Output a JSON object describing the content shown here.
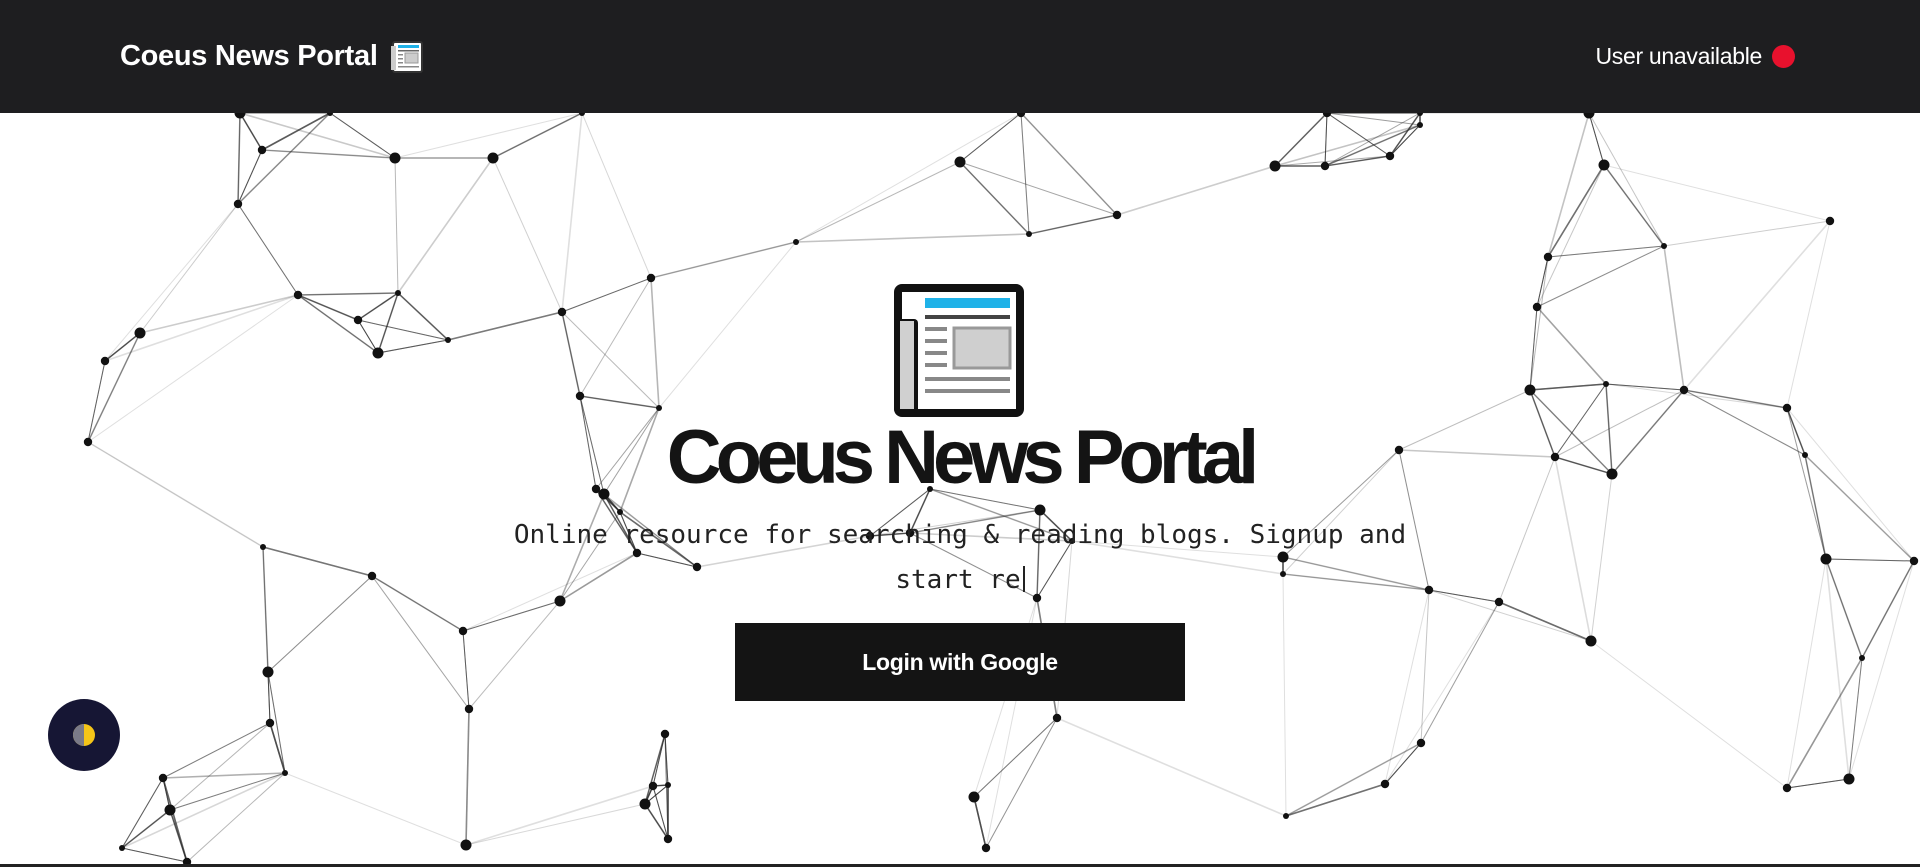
{
  "navbar": {
    "brand": "Coeus News Portal",
    "brand_icon": "newspaper-icon",
    "user_status": "User unavailable",
    "status_color": "#e8112d"
  },
  "hero": {
    "icon": "newspaper-icon",
    "title": "Coeus News Portal",
    "subtitle_line1": "Online resource for searching & reading blogs. Signup and",
    "subtitle_line2": "start re",
    "login_button": "Login with Google"
  },
  "theme_toggle": {
    "icon": "half-moon-icon"
  },
  "colors": {
    "navbar_bg": "#1e1e20",
    "button_bg": "#141414",
    "toggle_bg": "#161634",
    "accent_blue": "#1fb2e8"
  }
}
